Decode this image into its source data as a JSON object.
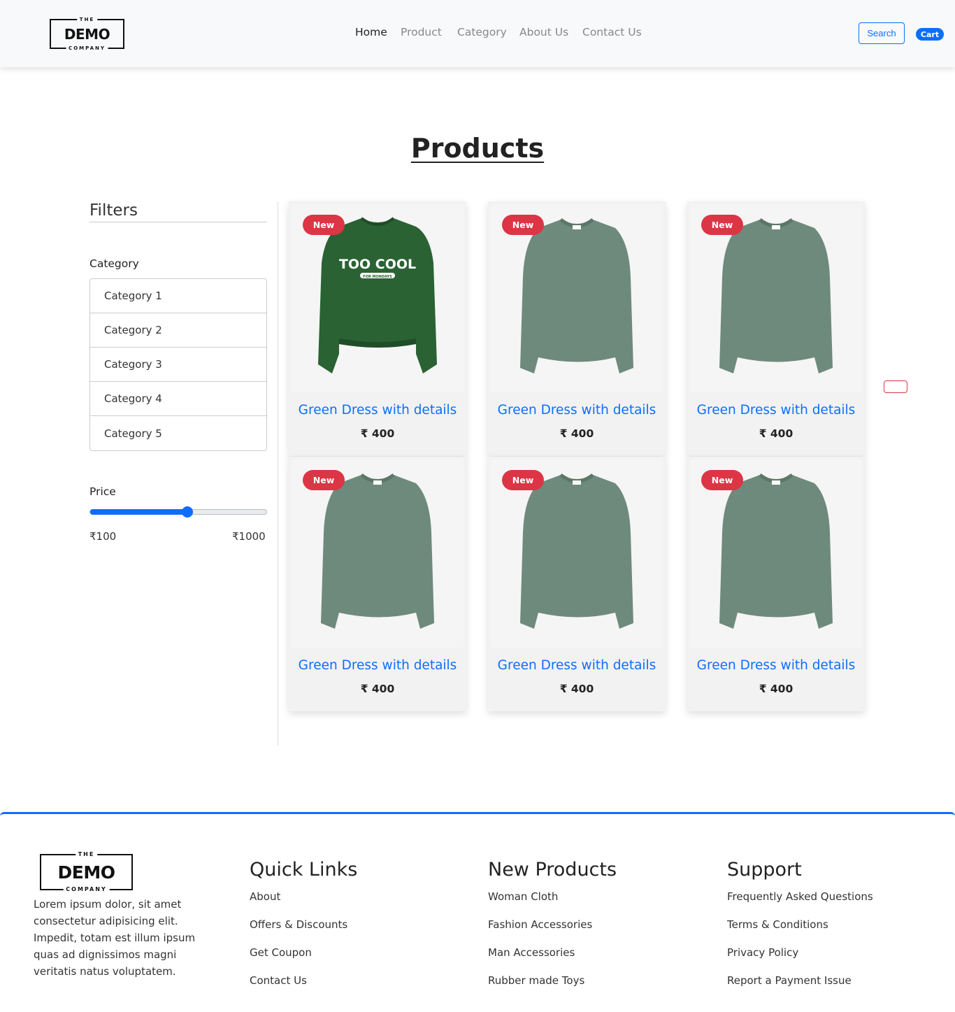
{
  "brand": {
    "top": "THE",
    "main": "DEMO",
    "bottom": "COMPANY"
  },
  "nav": {
    "links": [
      "Home",
      "Product",
      "Category",
      "About Us",
      "Contact Us"
    ],
    "search_label": "Search",
    "cart_label": "Cart"
  },
  "page_title": "Products",
  "filters": {
    "title": "Filters",
    "category_label": "Category",
    "categories": [
      "Category 1",
      "Category 2",
      "Category 3",
      "Category 4",
      "Category 5"
    ],
    "price_label": "Price",
    "price_min": "₹100",
    "price_max": "₹1000",
    "slider_fraction": 0.55
  },
  "products": [
    {
      "badge": "New",
      "name": "Green Dress with details",
      "price": "₹ 400",
      "image": "green-sweatshirt-too-cool"
    },
    {
      "badge": "New",
      "name": "Green Dress with details",
      "price": "₹ 400",
      "image": "sage-knit-sweater"
    },
    {
      "badge": "New",
      "name": "Green Dress with details",
      "price": "₹ 400",
      "image": "sage-knit-sweater"
    },
    {
      "badge": "New",
      "name": "Green Dress with details",
      "price": "₹ 400",
      "image": "sage-knit-sweater"
    },
    {
      "badge": "New",
      "name": "Green Dress with details",
      "price": "₹ 400",
      "image": "sage-knit-sweater"
    },
    {
      "badge": "New",
      "name": "Green Dress with details",
      "price": "₹ 400",
      "image": "sage-knit-sweater"
    }
  ],
  "sweatshirt_print": {
    "line1": "TOO COOL",
    "line2": "FOR MONDAYS"
  },
  "footer": {
    "about_text": "Lorem ipsum dolor, sit amet consectetur adipisicing elit. Impedit, totam est illum ipsum quas ad dignissimos magni veritatis natus voluptatem.",
    "columns": [
      {
        "heading": "Quick Links",
        "links": [
          "About",
          "Offers & Discounts",
          "Get Coupon",
          "Contact Us"
        ]
      },
      {
        "heading": "New Products",
        "links": [
          "Woman Cloth",
          "Fashion Accessories",
          "Man Accessories",
          "Rubber made Toys"
        ]
      },
      {
        "heading": "Support",
        "links": [
          "Frequently Asked Questions",
          "Terms & Conditions",
          "Privacy Policy",
          "Report a Payment Issue"
        ]
      }
    ]
  },
  "colors": {
    "accent": "#0d6efd",
    "badge": "#dc3545",
    "sweatshirt": "#2a6233",
    "sweater": "#6e8a7c",
    "navbar_bg": "#f8f9fa"
  }
}
